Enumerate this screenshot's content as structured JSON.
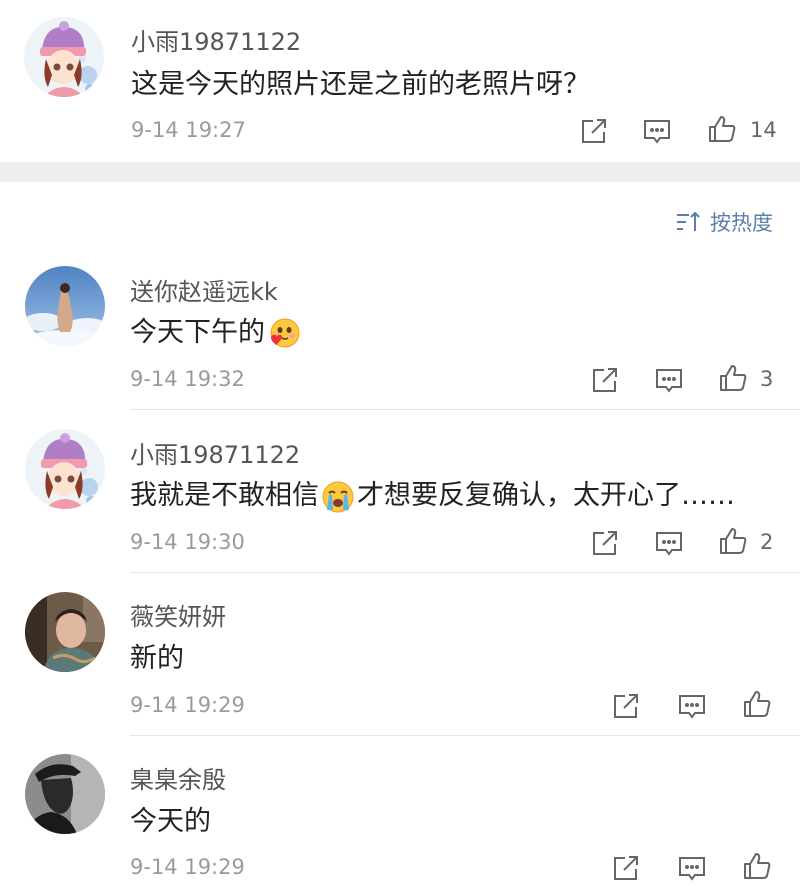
{
  "top_comment": {
    "username": "小雨19871122",
    "text": "这是今天的照片还是之前的老照片呀？",
    "time": "9-14 19:27",
    "likes": "14"
  },
  "sort": {
    "label": "按热度"
  },
  "comments": [
    {
      "username": "送你赵遥远kk",
      "text_before": "今天下午的",
      "emoji": "smiling-face-with-heart-emoji",
      "text_after": "",
      "time": "9-14 19:32",
      "likes": "3"
    },
    {
      "username": "小雨19871122",
      "text_before": "我就是不敢相信",
      "emoji": "crying-face-emoji",
      "text_after": "才想要反复确认，太开心了……",
      "time": "9-14 19:30",
      "likes": "2"
    },
    {
      "username": "薇笑妍妍",
      "text_before": "新的",
      "emoji": "",
      "text_after": "",
      "time": "9-14 19:29",
      "likes": ""
    },
    {
      "username": "臬臬余殷",
      "text_before": "今天的",
      "emoji": "",
      "text_after": "",
      "time": "9-14 19:29",
      "likes": ""
    }
  ],
  "icons": {
    "share": "share-icon",
    "comment": "comment-icon",
    "like": "thumbs-up-icon",
    "sort": "sort-icon"
  },
  "colors": {
    "link_blue": "#5b7fa8",
    "separator_band": "#eeeeee",
    "meta_gray": "#9a9a9a"
  }
}
